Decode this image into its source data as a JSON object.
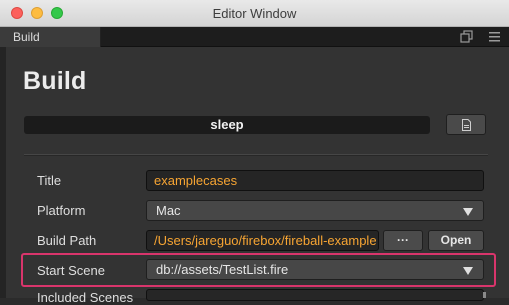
{
  "window": {
    "title": "Editor Window",
    "tab_label": "Build"
  },
  "panel": {
    "heading": "Build",
    "status": "sleep"
  },
  "fields": {
    "title": {
      "label": "Title",
      "value": "examplecases"
    },
    "platform": {
      "label": "Platform",
      "value": "Mac"
    },
    "build_path": {
      "label": "Build Path",
      "value": "/Users/jareguo/firebox/fireball-example"
    },
    "start_scene": {
      "label": "Start Scene",
      "value": "db://assets/TestList.fire"
    },
    "included_scenes": {
      "label": "Included Scenes"
    }
  },
  "buttons": {
    "browse": "···",
    "open": "Open"
  },
  "icons": {
    "popout": "popout-icon",
    "menu": "hamburger-menu-icon",
    "document": "document-icon",
    "dropdown": "chevron-down-icon"
  },
  "colors": {
    "accent_text": "#f7a533",
    "highlight_border": "#d9356c"
  }
}
